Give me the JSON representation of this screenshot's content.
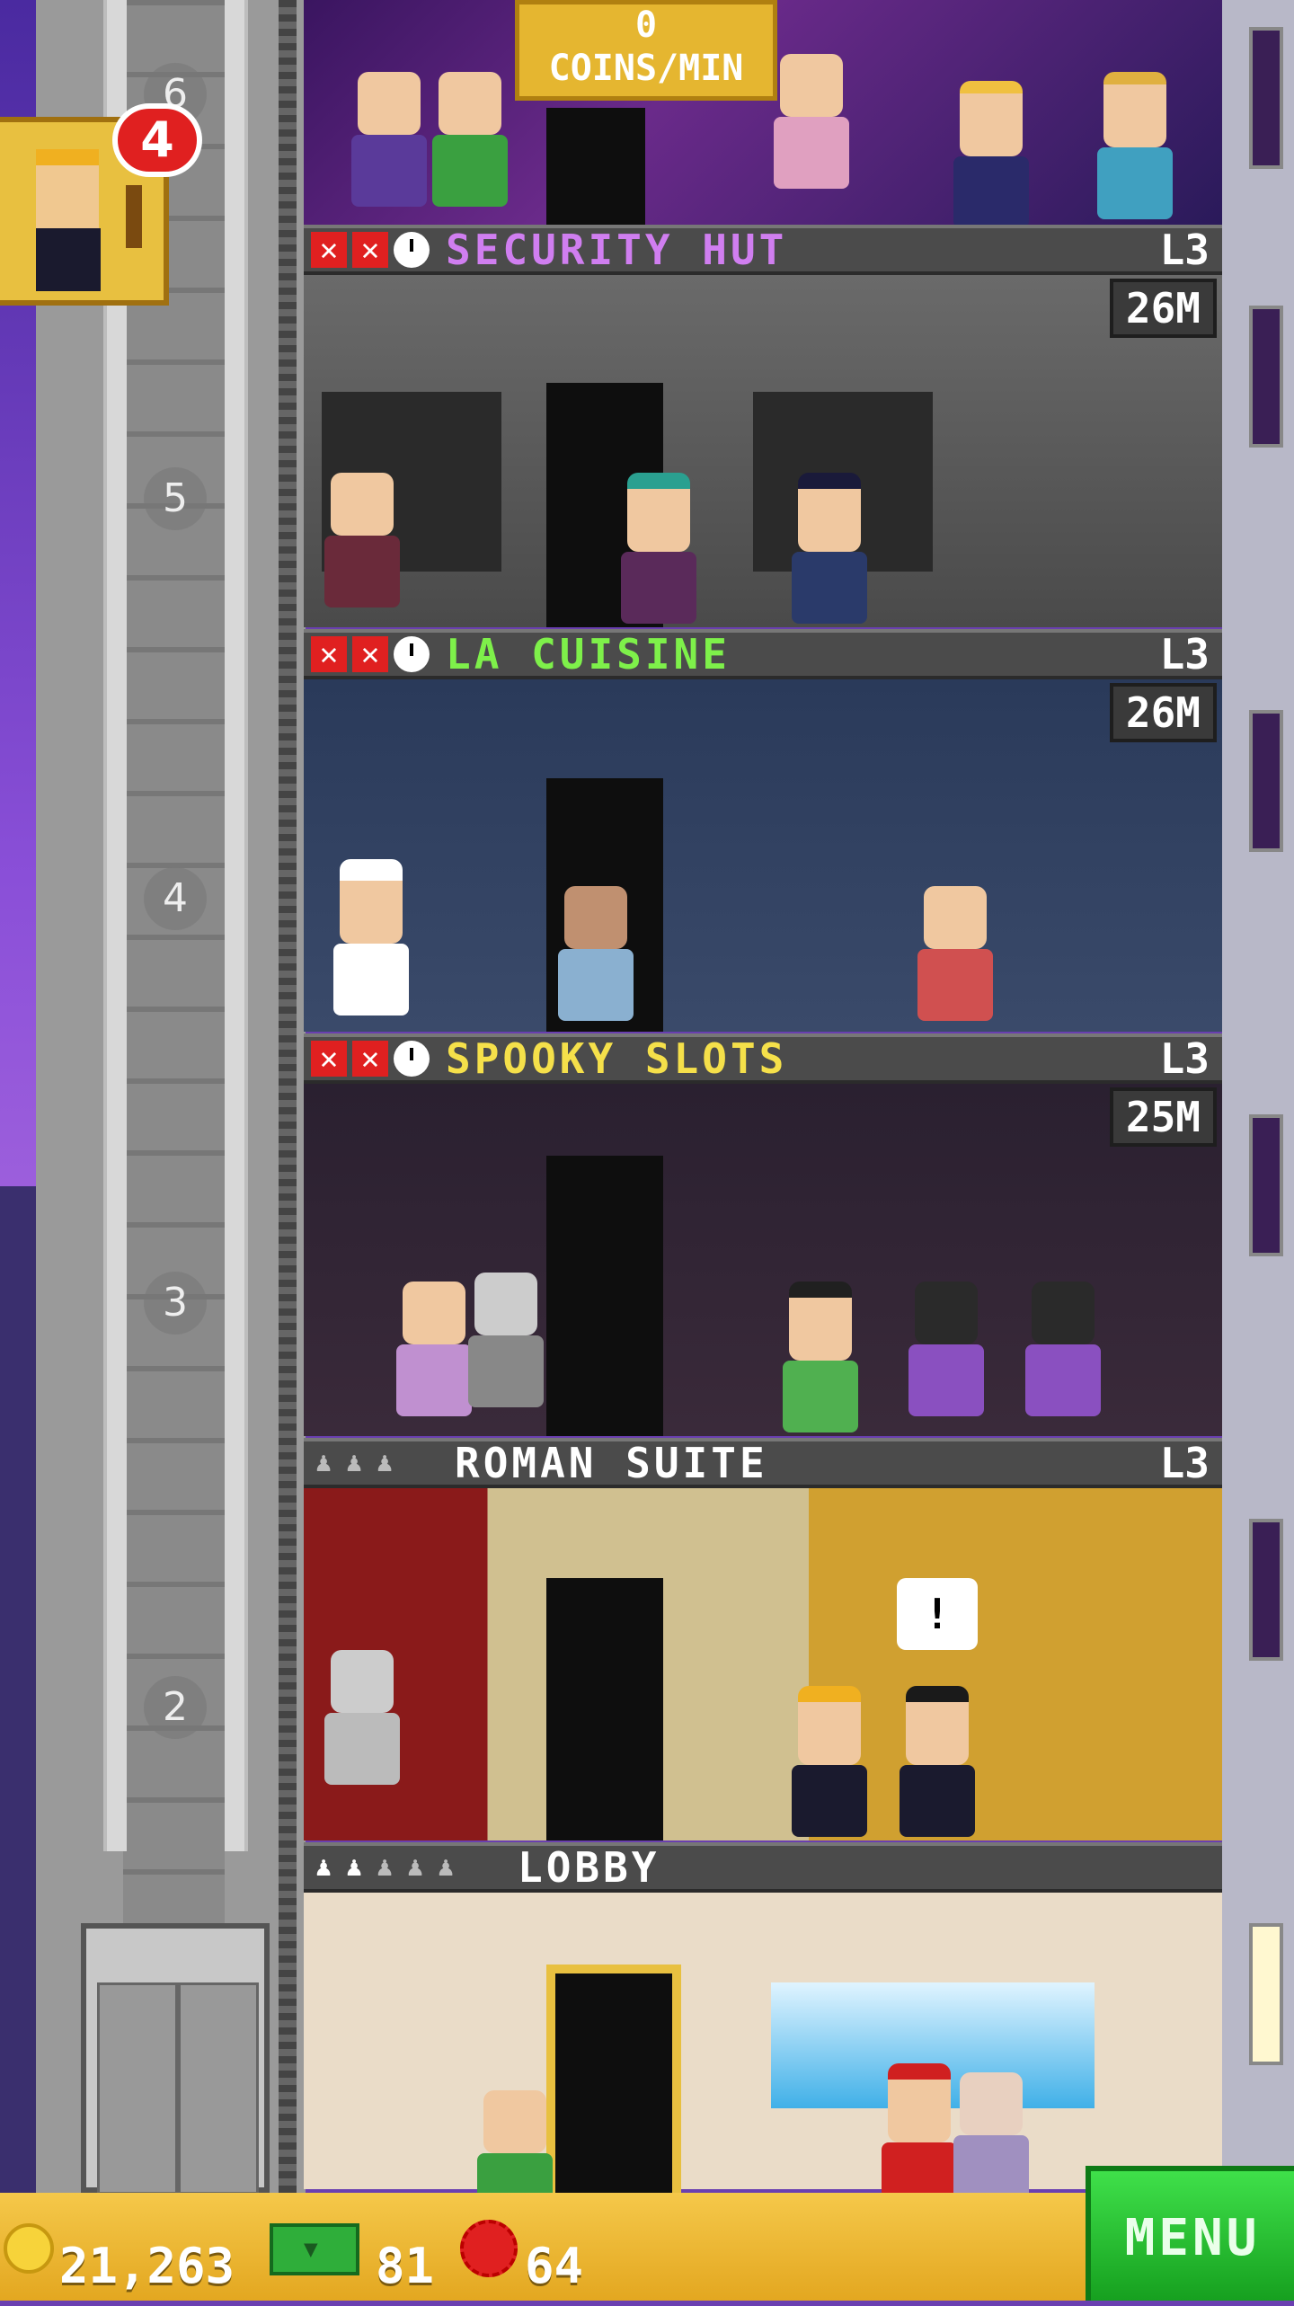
{
  "top_room": {
    "coins_per_min_value": "0",
    "coins_per_min_label": "COINS/MIN"
  },
  "notification": {
    "badge_count": "4",
    "icon": "bitizen-avatar-icon"
  },
  "elevator": {
    "floor_numbers": [
      "6",
      "5",
      "4",
      "3",
      "2"
    ]
  },
  "floors": [
    {
      "name": "SECURITY HUT",
      "name_color": "#d07ef0",
      "level": "L3",
      "timer": "26M",
      "status_icons": [
        "x-icon",
        "x-icon",
        "clock-icon"
      ]
    },
    {
      "name": "LA CUISINE",
      "name_color": "#7ef04a",
      "level": "L3",
      "timer": "26M",
      "status_icons": [
        "x-icon",
        "x-icon",
        "clock-icon"
      ]
    },
    {
      "name": "SPOOKY SLOTS",
      "name_color": "#f5e04a",
      "level": "L3",
      "timer": "25M",
      "status_icons": [
        "x-icon",
        "x-icon",
        "clock-icon"
      ]
    },
    {
      "name": "ROMAN SUITE",
      "name_color": "#ffffff",
      "level": "L3",
      "residents_filled": 0,
      "residents_total": 3
    },
    {
      "name": "LOBBY",
      "name_color": "#ffffff",
      "residents_filled": 2,
      "residents_total": 5
    }
  ],
  "bottom_bar": {
    "coins": "21,263",
    "bux": "81",
    "tokens": "64",
    "menu_label": "MENU"
  }
}
